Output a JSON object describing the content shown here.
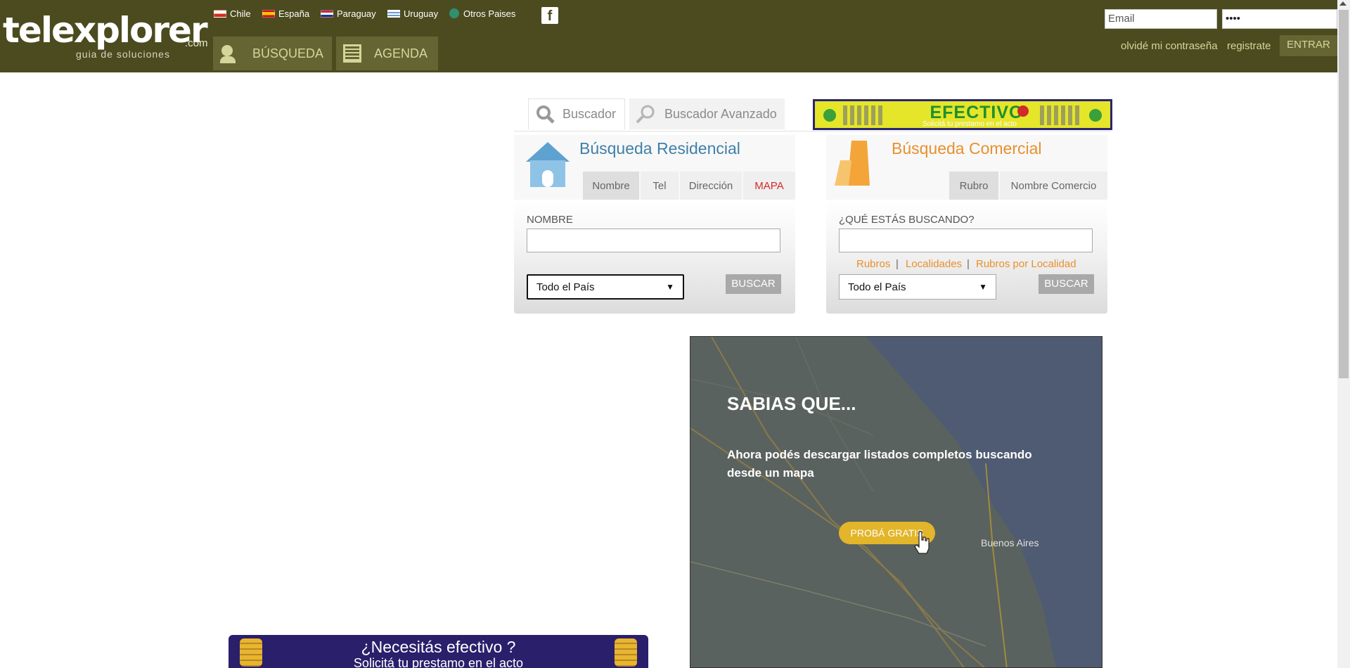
{
  "header": {
    "logo": "telexplorer",
    "logo_suffix": ".com",
    "logo_tagline": "guia de soluciones",
    "countries": [
      "Chile",
      "España",
      "Paraguay",
      "Uruguay",
      "Otros Paises"
    ],
    "facebook_icon": "facebook-icon",
    "nav": {
      "busqueda": "BÚSQUEDA",
      "agenda": "AGENDA"
    },
    "email_placeholder": "Email",
    "password_value": "••••",
    "forgot_link": "olvidé mi contraseña",
    "register_link": "registrate",
    "login_button": "ENTRAR"
  },
  "search_tabs": {
    "basic": "Buscador",
    "advanced": "Buscador Avanzado"
  },
  "banner": {
    "title": "EFECTIVO",
    "subtitle": "Solicitá tu prestamo en el acto"
  },
  "residential": {
    "title": "Búsqueda Residencial",
    "tabs": [
      "Nombre",
      "Tel",
      "Dirección",
      "MAPA"
    ],
    "field_label": "NOMBRE",
    "select_value": "Todo el País",
    "button": "BUSCAR"
  },
  "commercial": {
    "title": "Búsqueda Comercial",
    "tabs": [
      "Rubro",
      "Nombre Comercio"
    ],
    "field_label": "¿QUÉ ESTÁS BUSCANDO?",
    "links": [
      "Rubros",
      "Localidades",
      "Rubros por Localidad"
    ],
    "separator": "|",
    "select_value": "Todo el País",
    "button": "BUSCAR"
  },
  "map_ad": {
    "title": "SABIAS QUE...",
    "text": "Ahora podés descargar listados completos buscando desde un mapa",
    "button": "PROBÁ GRATIS",
    "city": "Buenos Aires"
  },
  "bottom_ad": {
    "title": "¿Necesitás efectivo ?",
    "subtitle": "Solicitá tu prestamo en el acto"
  },
  "colors": {
    "header_bg": "#4b4b1f",
    "nav_button": "#656533",
    "nav_text": "#d4d69a",
    "residential_accent": "#3f7fa8",
    "commercial_accent": "#e8902e",
    "mapa_red": "#d52a2a"
  }
}
